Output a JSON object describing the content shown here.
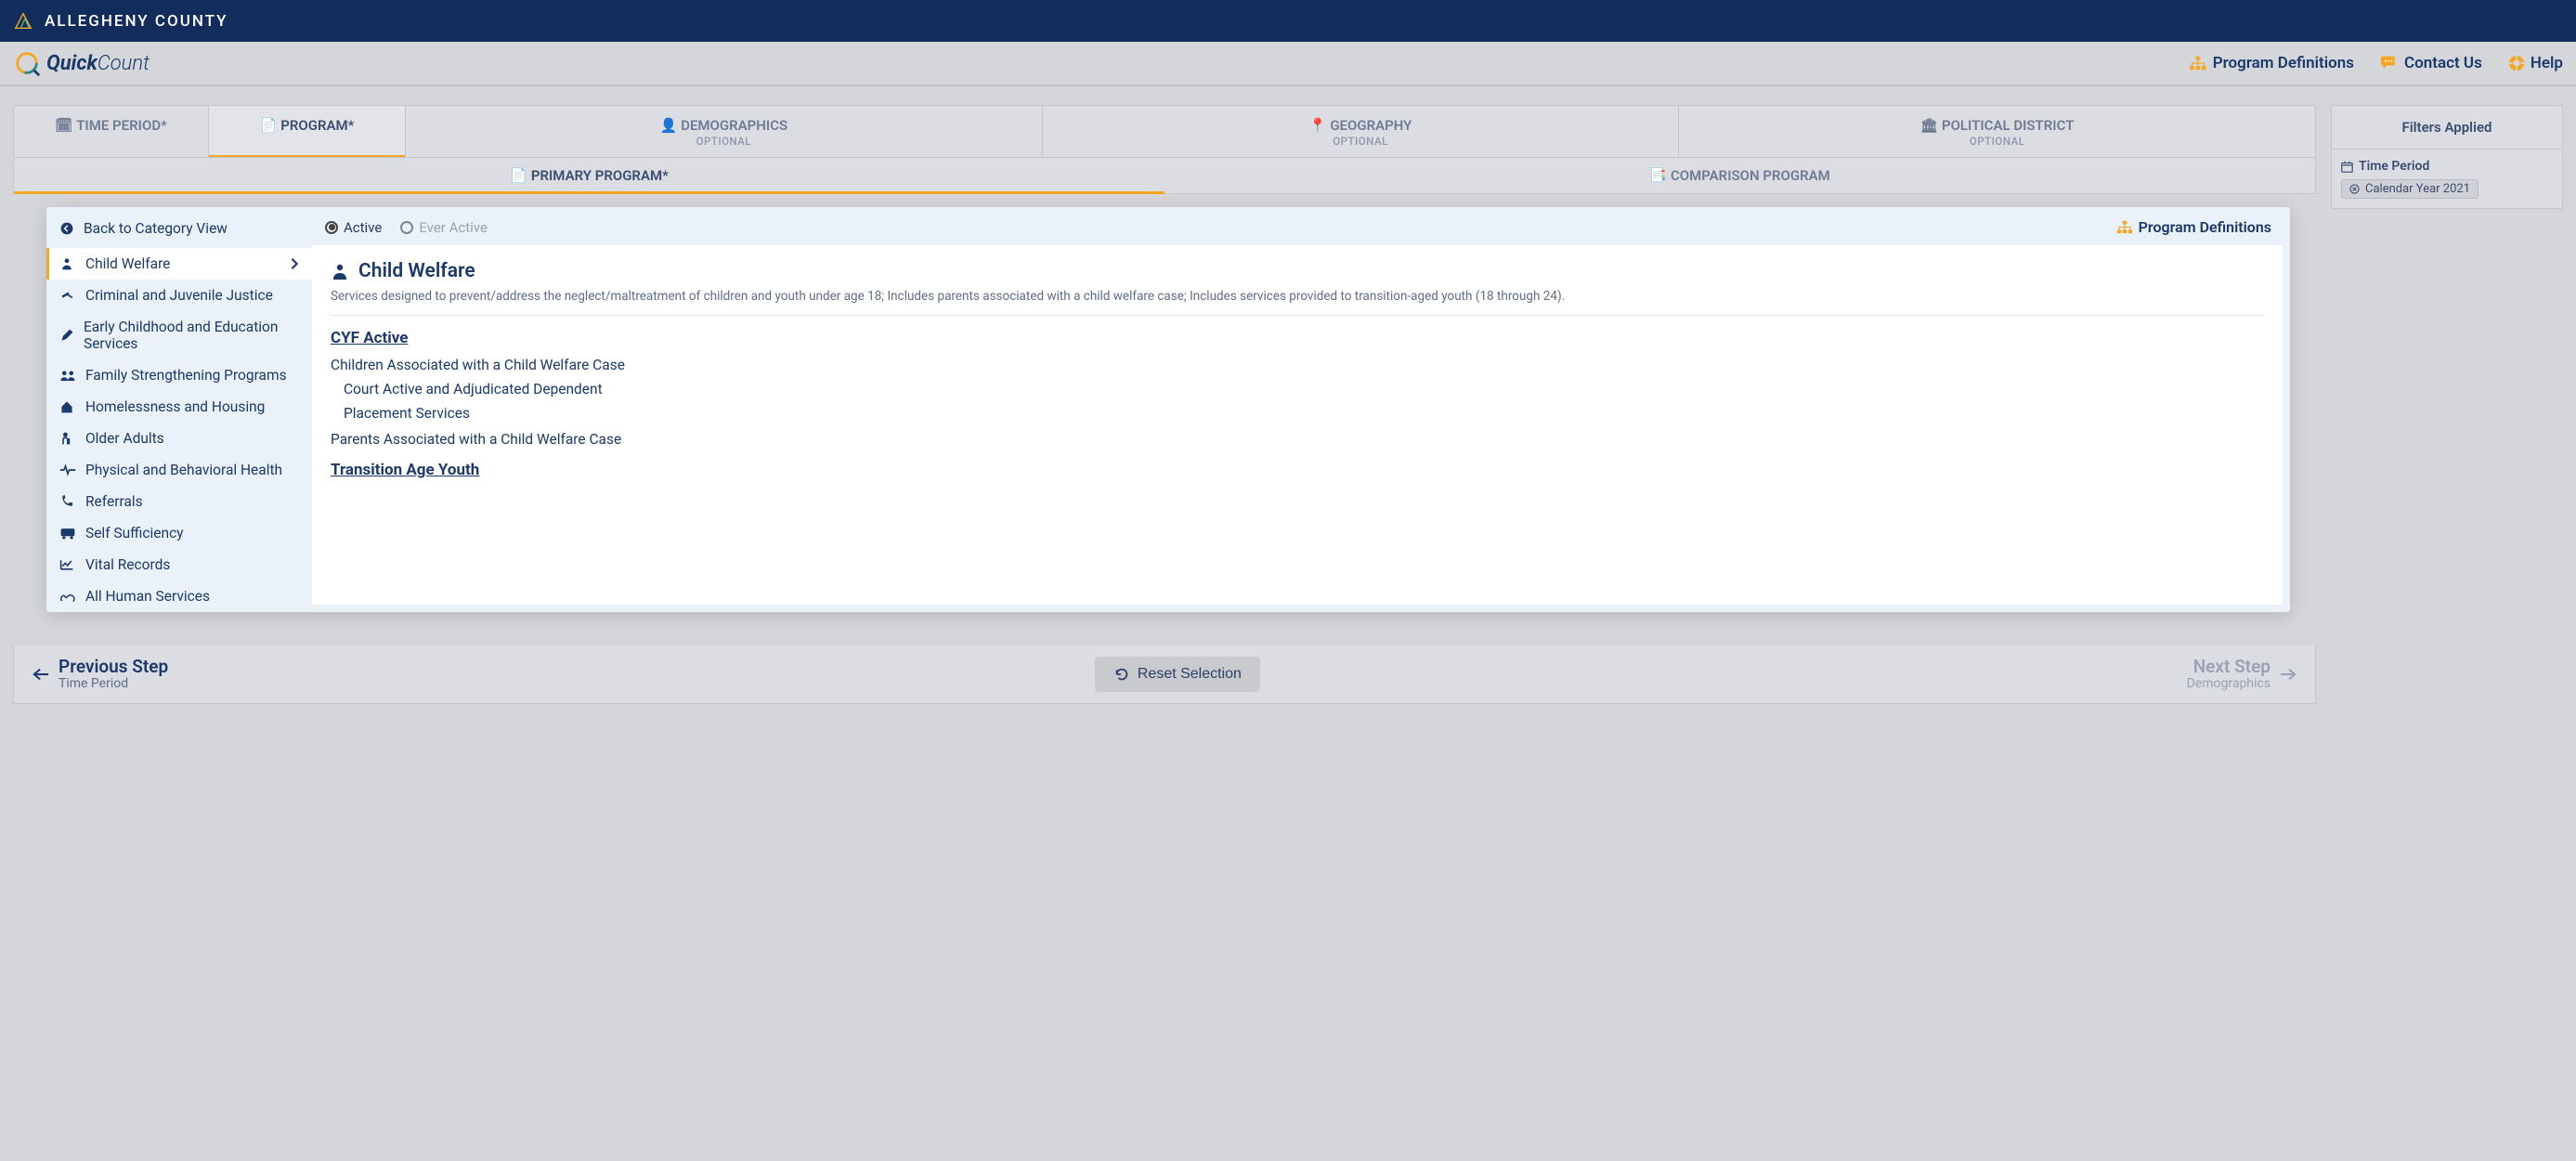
{
  "header": {
    "county": "ALLEGHENY COUNTY",
    "app_name_bold": "Quick",
    "app_name_light": "Count",
    "links": {
      "program_definitions": "Program Definitions",
      "contact_us": "Contact Us",
      "help": "Help"
    }
  },
  "steps": {
    "time_period": "TIME PERIOD*",
    "program": "PROGRAM*",
    "demographics": "DEMOGRAPHICS",
    "demographics_sub": "OPTIONAL",
    "geography": "GEOGRAPHY",
    "geography_sub": "OPTIONAL",
    "political": "POLITICAL DISTRICT",
    "political_sub": "OPTIONAL"
  },
  "subtabs": {
    "primary": "PRIMARY PROGRAM*",
    "comparison": "COMPARISON PROGRAM"
  },
  "category_panel": {
    "back": "Back to Category View",
    "items": [
      {
        "label": "Child Welfare"
      },
      {
        "label": "Criminal and Juvenile Justice"
      },
      {
        "label": "Early Childhood and Education Services"
      },
      {
        "label": "Family Strengthening Programs"
      },
      {
        "label": "Homelessness and Housing"
      },
      {
        "label": "Older Adults"
      },
      {
        "label": "Physical and Behavioral Health"
      },
      {
        "label": "Referrals"
      },
      {
        "label": "Self Sufficiency"
      },
      {
        "label": "Vital Records"
      },
      {
        "label": "All Human Services"
      }
    ]
  },
  "radios": {
    "active": "Active",
    "ever_active": "Ever Active"
  },
  "detail": {
    "prog_def_link": "Program Definitions",
    "title": "Child Welfare",
    "desc": "Services designed to prevent/address the neglect/maltreatment of children and youth under age 18; Includes parents associated with a child welfare case; Includes services provided to transition-aged youth (18 through 24).",
    "group1": "CYF Active",
    "g1_items": {
      "a": "Children Associated with a Child Welfare Case",
      "a1": "Court Active and Adjudicated Dependent",
      "a2": "Placement Services",
      "b": "Parents Associated with a Child Welfare Case"
    },
    "group2": "Transition Age Youth"
  },
  "footer": {
    "prev_big": "Previous Step",
    "prev_small": "Time Period",
    "reset": "Reset Selection",
    "next_big": "Next Step",
    "next_small": "Demographics"
  },
  "filters": {
    "title": "Filters Applied",
    "section1_label": "Time Period",
    "chip1": "Calendar Year 2021"
  }
}
